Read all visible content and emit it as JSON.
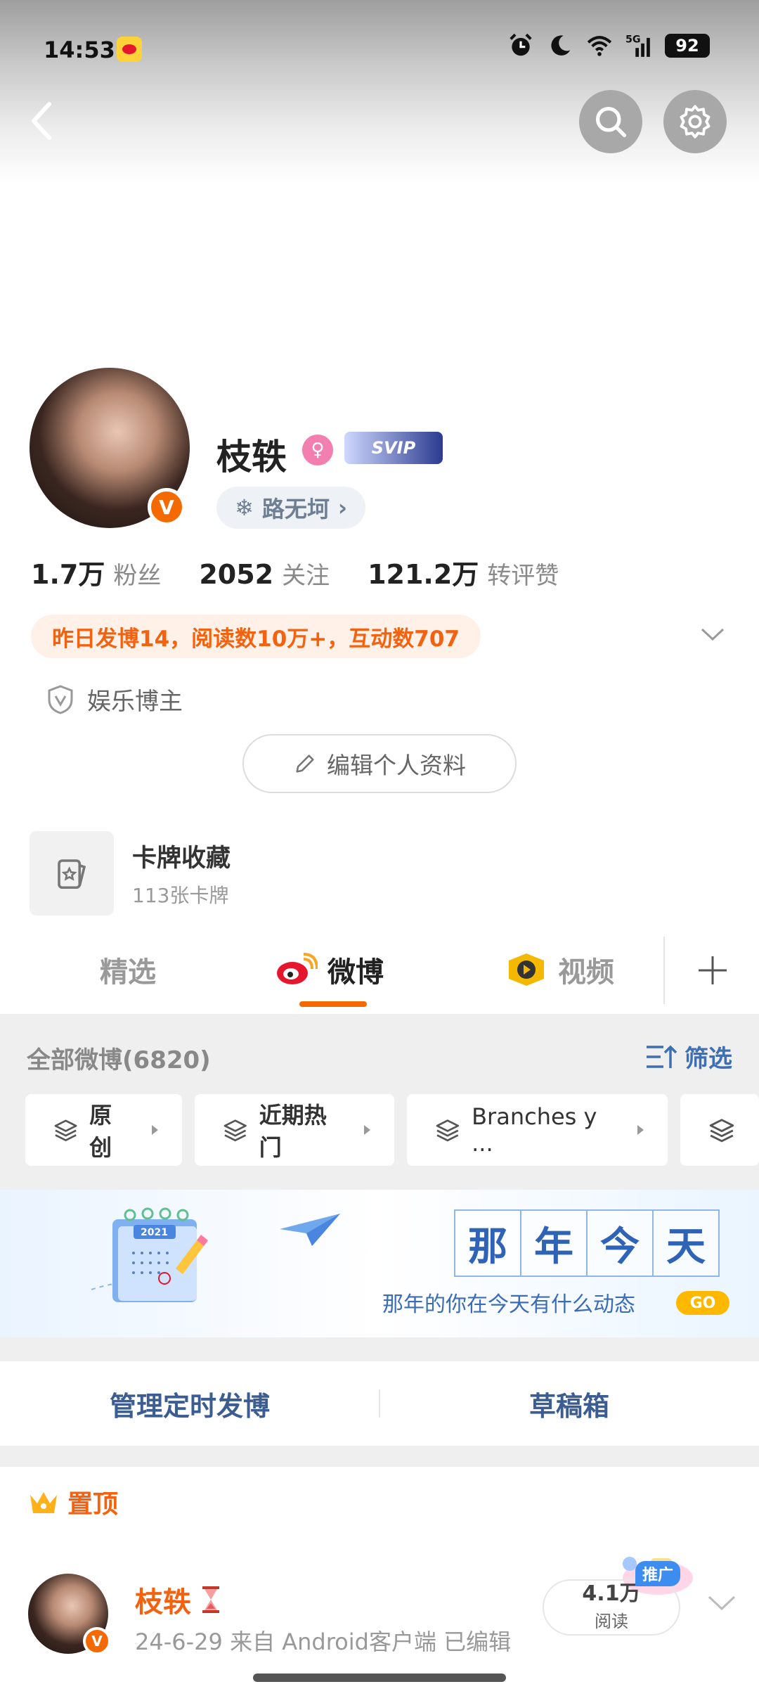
{
  "status_bar": {
    "time": "14:53",
    "network": "5G",
    "battery": "92"
  },
  "profile": {
    "name": "枝轶",
    "svip": "SVIP",
    "location": "路无坷",
    "stats": [
      {
        "value": "1.7万",
        "label": "粉丝"
      },
      {
        "value": "2052",
        "label": "关注"
      },
      {
        "value": "121.2万",
        "label": "转评赞"
      }
    ],
    "activity": "昨日发博14，阅读数10万+，互动数707",
    "category": "娱乐博主",
    "edit_button": "编辑个人资料",
    "card": {
      "title": "卡牌收藏",
      "subtitle": "113张卡牌"
    }
  },
  "tabs": [
    {
      "label": "精选"
    },
    {
      "label": "微博"
    },
    {
      "label": "视频"
    }
  ],
  "feed": {
    "all_weibo": "全部微博(6820)",
    "filter": "筛选",
    "chips": [
      "原创",
      "近期热门",
      "Branches y ..."
    ]
  },
  "banner": {
    "chars": [
      "那",
      "年",
      "今",
      "天"
    ],
    "subtitle": "那年的你在今天有什么动态",
    "go": "GO",
    "calendar_year": "2021"
  },
  "manage": {
    "scheduled": "管理定时发博",
    "drafts": "草稿箱"
  },
  "pinned": {
    "label": "置顶"
  },
  "post": {
    "author": "枝轶",
    "meta": "24-6-29  来自 Android客户端  已编辑",
    "reads": "4.1万",
    "reads_label": "阅读",
    "promo": "推广"
  },
  "colors": {
    "accent": "#f56a00",
    "link_blue": "#3f6fb3",
    "activity_bg": "#fff1e8"
  }
}
